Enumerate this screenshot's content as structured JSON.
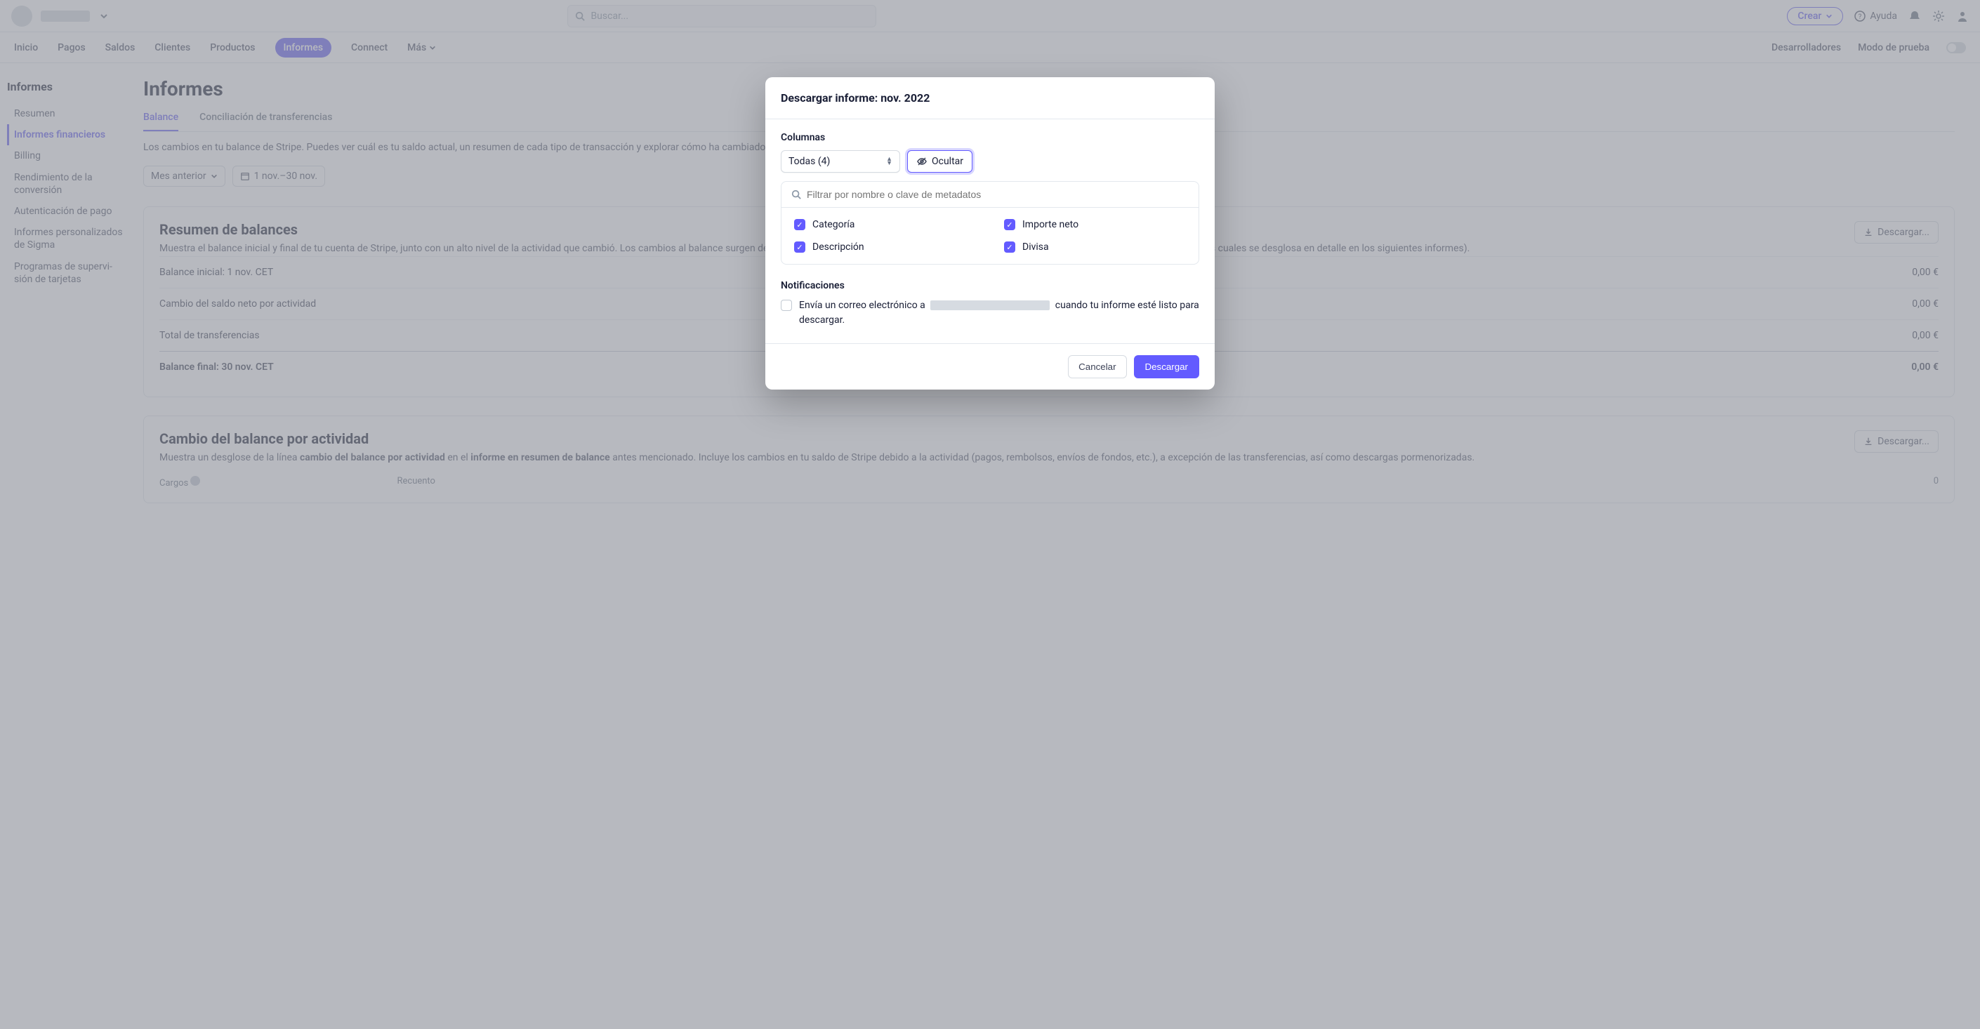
{
  "topbar": {
    "search_placeholder": "Buscar...",
    "create_label": "Crear",
    "help_label": "Ayuda"
  },
  "mainnav": {
    "items": [
      "Inicio",
      "Pagos",
      "Saldos",
      "Clientes",
      "Productos",
      "Informes",
      "Connect",
      "Más"
    ],
    "active_index": 5,
    "dev_label": "Desarrolladores",
    "testmode_label": "Modo de prueba"
  },
  "sidebar": {
    "title": "Informes",
    "items": [
      "Resumen",
      "Informes financieros",
      "Billing",
      "Rendimiento de la conversión",
      "Autenticación de pago",
      "Informes personaliza­dos de Sigma",
      "Programas de supervi­sión de tarjetas"
    ],
    "active_index": 1
  },
  "page": {
    "title": "Informes",
    "tabs": [
      "Balance",
      "Conciliación de transferencias"
    ],
    "active_tab": 0,
    "description": "Los cambios en tu balance de Stripe. Puedes ver cuál es tu saldo actual, un resumen de cada tipo de transacción y explorar cómo ha cambiado tu saldo de Stripe.",
    "filter_period": "Mes anterior",
    "filter_range": "1 nov.–30 nov."
  },
  "summary_card": {
    "title": "Resumen de balances",
    "desc": "Muestra el balance inicial y final de tu cuenta de Stripe, junto con un alto nivel de la actividad que cambió. Los cambios al balance surgen de la actividad (pagos, rembolsos, etc.) y de transferencias a tu cuenta bancaria (retiros), cada uno de los cuales se desglosa en detalle en los siguientes informes).",
    "download_label": "Descargar...",
    "rows": [
      {
        "label": "Balance inicial: 1 nov. CET",
        "value": "0,00 €"
      },
      {
        "label": "Cambio del saldo neto por actividad",
        "value": "0,00 €"
      },
      {
        "label": "Total de transferencias",
        "value": "0,00 €"
      },
      {
        "label": "Balance final: 30 nov. CET",
        "value": "0,00 €"
      }
    ]
  },
  "activity_card": {
    "title": "Cambio del balance por actividad",
    "desc_pre": "Muestra un desglose de la línea ",
    "desc_bold1": "cambio del balance por actividad",
    "desc_mid1": " en el ",
    "desc_bold2": "informe en resumen de balance",
    "desc_post": " antes mencionado. Incluye los cambios en tu saldo de Stripe debido a la actividad (pagos, rembolsos, envíos de fondos, etc.), a excepción de las transferencias, así como descargas pormenorizadas.",
    "download_label": "Descargar...",
    "col_charges": "Cargos",
    "col_count": "Recuento",
    "count_value": "0"
  },
  "modal": {
    "title": "Descargar informe: nov. 2022",
    "columns_label": "Columnas",
    "select_label": "Todas (4)",
    "hide_label": "Ocultar",
    "filter_placeholder": "Filtrar por nombre o clave de metadatos",
    "checks": [
      "Categoría",
      "Importe neto",
      "Descripción",
      "Divisa"
    ],
    "notif_label": "Notificaciones",
    "notif_pre": "Envía un correo electrónico a ",
    "notif_post": " cuando tu informe esté listo para descargar.",
    "cancel_label": "Cancelar",
    "download_label": "Descargar"
  }
}
